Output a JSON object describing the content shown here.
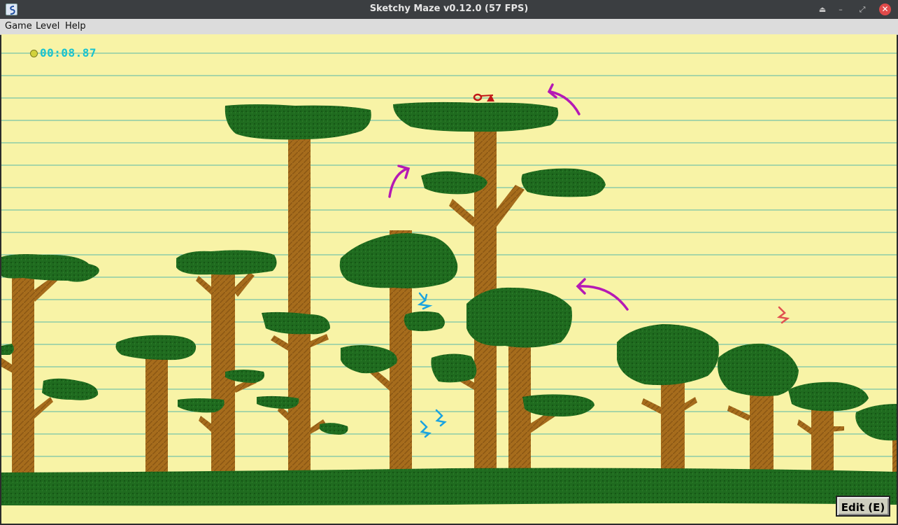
{
  "window": {
    "title": "Sketchy Maze v0.12.0 (57 FPS)",
    "app_icon": "doodle-icon",
    "controls": {
      "eject_icon": "⏏",
      "minimize_icon": "–",
      "restore_icon": "⤢",
      "close_icon": "✕"
    }
  },
  "menubar": {
    "items": [
      "Game",
      "Level",
      "Help"
    ]
  },
  "hud": {
    "timer": "00:08.87"
  },
  "edit_button": {
    "label": "Edit (E)"
  },
  "colors": {
    "paper": "#f8f3a6",
    "ruled_line": "#56b7a8",
    "leaf": "#1e6a1e",
    "trunk": "#a26a1e",
    "arrow": "#b519b5",
    "player": "#1aa3e0",
    "enemy": "#e05050",
    "timer": "#19c3cf"
  }
}
